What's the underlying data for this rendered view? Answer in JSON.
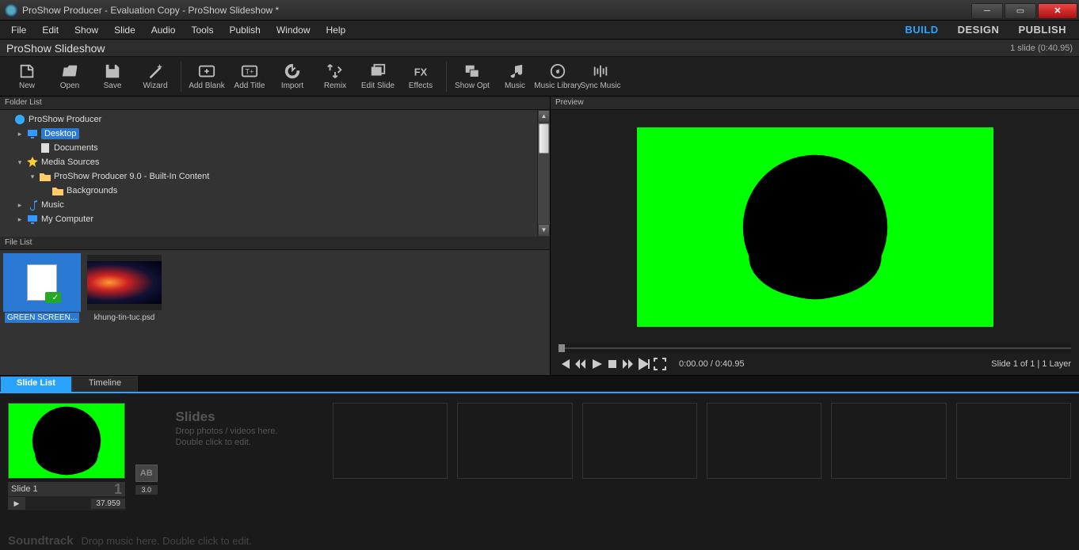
{
  "window": {
    "title": "ProShow Producer - Evaluation Copy - ProShow Slideshow *"
  },
  "menu": {
    "items": [
      "File",
      "Edit",
      "Show",
      "Slide",
      "Audio",
      "Tools",
      "Publish",
      "Window",
      "Help"
    ]
  },
  "modes": {
    "build": "BUILD",
    "design": "DESIGN",
    "publish": "PUBLISH",
    "active": "build"
  },
  "project": {
    "name": "ProShow Slideshow",
    "status": "1 slide (0:40.95)"
  },
  "toolbar": {
    "items": [
      {
        "id": "new",
        "label": "New"
      },
      {
        "id": "open",
        "label": "Open"
      },
      {
        "id": "save",
        "label": "Save"
      },
      {
        "id": "wizard",
        "label": "Wizard"
      },
      {
        "sep": true
      },
      {
        "id": "addblank",
        "label": "Add Blank"
      },
      {
        "id": "addtitle",
        "label": "Add Title"
      },
      {
        "id": "import",
        "label": "Import"
      },
      {
        "id": "remix",
        "label": "Remix"
      },
      {
        "id": "editslide",
        "label": "Edit Slide"
      },
      {
        "id": "effects",
        "label": "Effects"
      },
      {
        "sep": true
      },
      {
        "id": "showopt",
        "label": "Show Opt"
      },
      {
        "id": "music",
        "label": "Music"
      },
      {
        "id": "musiclib",
        "label": "Music Library"
      },
      {
        "id": "syncmusic",
        "label": "Sync Music"
      }
    ]
  },
  "panels": {
    "folder": "Folder List",
    "file": "File List",
    "preview": "Preview"
  },
  "tree": [
    {
      "depth": 0,
      "tw": "",
      "icon": "app",
      "label": "ProShow Producer"
    },
    {
      "depth": 1,
      "tw": "▸",
      "icon": "monitor",
      "label": "Desktop",
      "sel": true
    },
    {
      "depth": 2,
      "tw": "",
      "icon": "doc",
      "label": "Documents"
    },
    {
      "depth": 1,
      "tw": "▾",
      "icon": "star",
      "label": "Media Sources"
    },
    {
      "depth": 2,
      "tw": "▾",
      "icon": "folder",
      "label": "ProShow Producer 9.0 - Built-In Content"
    },
    {
      "depth": 3,
      "tw": "",
      "icon": "folder",
      "label": "Backgrounds"
    },
    {
      "depth": 1,
      "tw": "▸",
      "icon": "note",
      "label": "Music"
    },
    {
      "depth": 1,
      "tw": "▸",
      "icon": "monitor",
      "label": "My Computer"
    }
  ],
  "files": [
    {
      "name": "GREEN SCREEN...",
      "kind": "greenfile",
      "sel": true
    },
    {
      "name": "khung-tin-tuc.psd",
      "kind": "nebula",
      "sel": false
    }
  ],
  "preview": {
    "time": "0:00.00 / 0:40.95",
    "info": "Slide 1 of 1  |  1 Layer"
  },
  "tabs": {
    "slidelist": "Slide List",
    "timeline": "Timeline",
    "active": "slidelist"
  },
  "slide": {
    "label": "Slide 1",
    "num": "1",
    "dur": "37.959",
    "transdur": "3.0",
    "transicon": "AB"
  },
  "dropslides": {
    "title": "Slides",
    "line1": "Drop photos / videos here.",
    "line2": "Double click to edit."
  },
  "soundtrack": {
    "title": "Soundtrack",
    "hint": "Drop music here.  Double click to edit."
  }
}
